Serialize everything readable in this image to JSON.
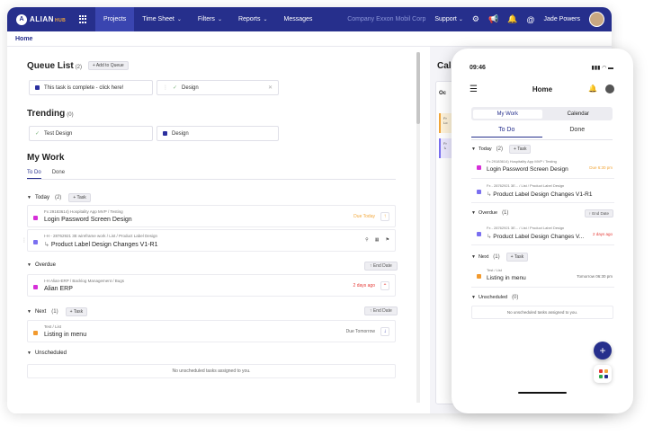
{
  "navbar": {
    "logo_text": "ALIAN",
    "logo_suffix": "HUB",
    "items": [
      {
        "label": "Projects",
        "caret": ""
      },
      {
        "label": "Time Sheet",
        "caret": "⌄"
      },
      {
        "label": "Filters",
        "caret": "⌄"
      },
      {
        "label": "Reports",
        "caret": "⌄"
      },
      {
        "label": "Messages",
        "caret": ""
      }
    ],
    "company": "Company Exxon Mobil Corp",
    "support": "Support",
    "user_name": "Jade Powers"
  },
  "breadcrumb": "Home",
  "queue": {
    "title": "Queue List",
    "count": "(2)",
    "add_label": "+ Add to Queue",
    "chips": [
      {
        "label": "This task is complete - click here!",
        "color": "#2b2f9e"
      },
      {
        "label": "Design",
        "icon": "check"
      }
    ]
  },
  "trending": {
    "title": "Trending",
    "count": "(0)",
    "chips": [
      {
        "label": "Test Design",
        "icon": "check"
      },
      {
        "label": "Design",
        "color": "#2b2f9e"
      }
    ]
  },
  "my_work": {
    "title": "My Work",
    "tabs": [
      "To Do",
      "Done"
    ],
    "today": {
      "label": "Today",
      "count": "(2)",
      "add_label": "+ Task",
      "tasks": [
        {
          "crumb": "Fx 29183614) Hospitality App MVP / Testing",
          "name": "Login Password Screen Design",
          "due": "Due Today",
          "color": "#d62fd8",
          "due_color": "#f2a73b"
        },
        {
          "crumb": "I-H - 28762921 3E wireframe work / List / Product Label Design",
          "name": "Product Label Design Changes V1-R1",
          "due": "",
          "color": "#7a6ff0"
        }
      ]
    },
    "overdue": {
      "label": "Overdue",
      "end_label": "↑ End Date",
      "tasks": [
        {
          "crumb": "I-H Alian-ERP / Backlog Management / Bugs",
          "name": "Alian ERP",
          "due": "2 days ago",
          "color": "#d62fd8",
          "due_color": "#e53935"
        }
      ]
    },
    "next": {
      "label": "Next",
      "count": "(1)",
      "add_label": "+ Task",
      "end_label": "↑ End Date",
      "tasks": [
        {
          "crumb": "Test / List",
          "name": "Listing in menu",
          "due": "Due Tomorrow",
          "color": "#f29a2e",
          "due_color": "#666666"
        }
      ]
    },
    "unscheduled": {
      "label": "Unscheduled",
      "empty": "No unscheduled tasks assigned to you."
    }
  },
  "calendar": {
    "title": "Calendar",
    "header": "Oc"
  },
  "phone": {
    "time": "09:46",
    "title": "Home",
    "segments": [
      "My Work",
      "Calendar"
    ],
    "tabs": [
      "To Do",
      "Done"
    ],
    "today": {
      "label": "Today",
      "count": "(2)",
      "add_label": "+ Task",
      "tasks": [
        {
          "crumb": "Fx 29183614) Hospitality App MVP / Testing",
          "name": "Login Password Screen Design",
          "due": "Due 6:30 pm",
          "color": "#d62fd8",
          "due_color": "#f2a73b"
        },
        {
          "crumb": "Fx - 28762921 3E... / List / Product Label Design",
          "name": "Product Label Design Changes V1-R1",
          "due": "",
          "color": "#7a6ff0"
        }
      ]
    },
    "overdue": {
      "label": "Overdue",
      "count": "(1)",
      "end_label": "↑ End Date",
      "tasks": [
        {
          "crumb": "Fx - 28762921 3E... / List / Product Label Design",
          "name": "Product Label Design Changes V...",
          "due": "2 days ago",
          "color": "#7a6ff0",
          "due_color": "#e53935"
        }
      ]
    },
    "next": {
      "label": "Next",
      "count": "(1)",
      "add_label": "+ Task",
      "tasks": [
        {
          "crumb": "Test / List",
          "name": "Listing in menu",
          "due": "Tomorrow 06:30 pm",
          "color": "#f29a2e",
          "due_color": "#666666"
        }
      ]
    },
    "unscheduled": {
      "label": "Unscheduled",
      "count": "(0)",
      "empty": "No unscheduled tasks assigned to you."
    }
  }
}
